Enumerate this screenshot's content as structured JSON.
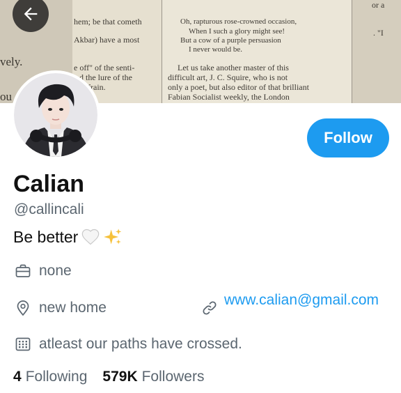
{
  "banner": {
    "lines_a": [
      "vely.",
      "ou"
    ],
    "lines_b": [
      "hem; be that cometh",
      "Akbar) have a most",
      "e off\" of the senti-",
      "d the lure of the",
      "frain."
    ],
    "lines_c": [
      "Oh, rapturous rose-crowned occasion,",
      "When I such a glory might see!",
      "But a cow of a purple persuasion",
      "I never would be.",
      "Let us take another master of this",
      "difficult art, J. C. Squire, who is not",
      "only a poet, but also editor of that brilliant",
      "Fabian Socialist weekly, the London"
    ],
    "lines_d": [
      "or a",
      ". \"I"
    ]
  },
  "profile": {
    "name": "Calian",
    "handle": "@callincali",
    "bio": "Be better",
    "follow_label": "Follow"
  },
  "meta": {
    "work": "none",
    "location": "new home",
    "website": "www.calian@gmail.com",
    "joined": "atleast our paths have crossed."
  },
  "stats": {
    "following_count": "4",
    "following_label": "Following",
    "followers_count": "579K",
    "followers_label": "Followers"
  },
  "colors": {
    "accent": "#1d9bf0",
    "text": "#111111",
    "muted": "#5b6670"
  }
}
